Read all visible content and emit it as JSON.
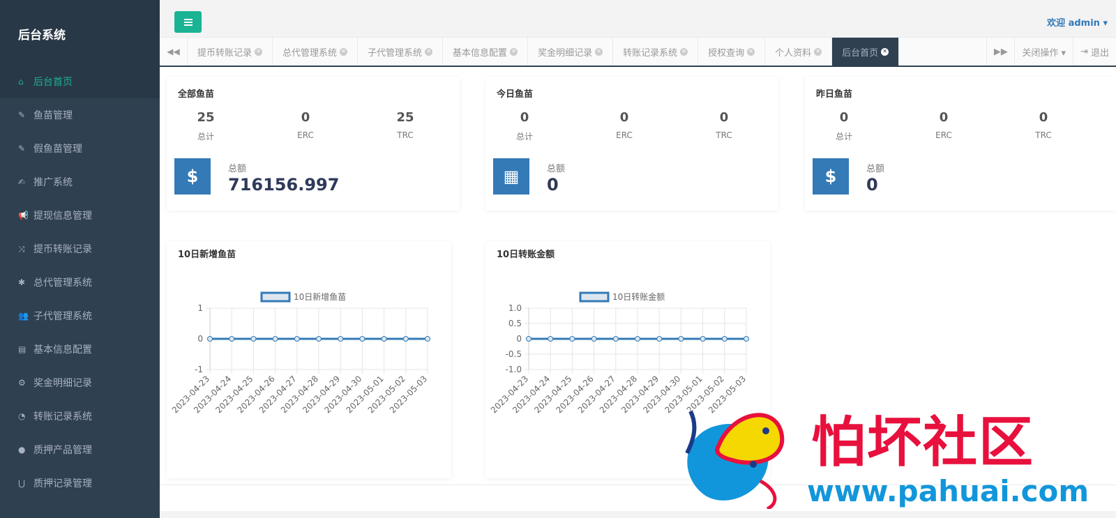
{
  "app": {
    "brand": "后台系统"
  },
  "sidebar": {
    "items": [
      {
        "label": "后台首页",
        "icon": "home-icon",
        "active": true
      },
      {
        "label": "鱼苗管理",
        "icon": "wrench-icon"
      },
      {
        "label": "假鱼苗管理",
        "icon": "wrench-icon"
      },
      {
        "label": "推广系统",
        "icon": "edit-icon"
      },
      {
        "label": "提现信息管理",
        "icon": "bullhorn-icon"
      },
      {
        "label": "提币转账记录",
        "icon": "random-icon"
      },
      {
        "label": "总代管理系统",
        "icon": "asterisk-icon"
      },
      {
        "label": "子代管理系统",
        "icon": "users-icon"
      },
      {
        "label": "基本信息配置",
        "icon": "file-icon"
      },
      {
        "label": "奖金明细记录",
        "icon": "cogs-icon"
      },
      {
        "label": "转账记录系统",
        "icon": "dashboard-icon"
      },
      {
        "label": "质押产品管理",
        "icon": "comment-icon"
      },
      {
        "label": "质押记录管理",
        "icon": "magnet-icon"
      }
    ]
  },
  "topbar": {
    "welcome": "欢迎 admin ▾"
  },
  "tabs": {
    "items": [
      {
        "label": "提币转账记录"
      },
      {
        "label": "总代管理系统"
      },
      {
        "label": "子代管理系统"
      },
      {
        "label": "基本信息配置"
      },
      {
        "label": "奖金明细记录"
      },
      {
        "label": "转账记录系统"
      },
      {
        "label": "授权查询"
      },
      {
        "label": "个人资料"
      },
      {
        "label": "后台首页",
        "active": true
      }
    ],
    "close_ops": "关闭操作 ▾",
    "logout": "退出"
  },
  "stats": [
    {
      "title": "全部鱼苗",
      "total": "25",
      "erc": "0",
      "trc": "25",
      "total_label": "总计",
      "erc_label": "ERC",
      "trc_label": "TRC",
      "amount_label": "总额",
      "amount": "716156.997",
      "icon": "dollar-icon"
    },
    {
      "title": "今日鱼苗",
      "total": "0",
      "erc": "0",
      "trc": "0",
      "total_label": "总计",
      "erc_label": "ERC",
      "trc_label": "TRC",
      "amount_label": "总额",
      "amount": "0",
      "icon": "archive-icon"
    },
    {
      "title": "昨日鱼苗",
      "total": "0",
      "erc": "0",
      "trc": "0",
      "total_label": "总计",
      "erc_label": "ERC",
      "trc_label": "TRC",
      "amount_label": "总额",
      "amount": "0",
      "icon": "dollar-icon"
    }
  ],
  "chart_data": [
    {
      "type": "line",
      "title": "10日新增鱼苗",
      "categories": [
        "2023-04-23",
        "2023-04-24",
        "2023-04-25",
        "2023-04-26",
        "2023-04-27",
        "2023-04-28",
        "2023-04-29",
        "2023-04-30",
        "2023-05-01",
        "2023-05-02",
        "2023-05-03"
      ],
      "series": [
        {
          "name": "10日新增鱼苗",
          "values": [
            0,
            0,
            0,
            0,
            0,
            0,
            0,
            0,
            0,
            0,
            0
          ]
        }
      ],
      "ylim": [
        -1,
        1
      ],
      "yticks": [
        "1",
        "0",
        "-1"
      ],
      "grid": true,
      "legend": "top",
      "color": "#337ab7"
    },
    {
      "type": "line",
      "title": "10日转账金额",
      "categories": [
        "2023-04-23",
        "2023-04-24",
        "2023-04-25",
        "2023-04-26",
        "2023-04-27",
        "2023-04-28",
        "2023-04-29",
        "2023-04-30",
        "2023-05-01",
        "2023-05-02",
        "2023-05-03"
      ],
      "series": [
        {
          "name": "10日转账金额",
          "values": [
            0,
            0,
            0,
            0,
            0,
            0,
            0,
            0,
            0,
            0,
            0
          ]
        }
      ],
      "ylim": [
        -1,
        1
      ],
      "yticks": [
        "1.0",
        "0.5",
        "0",
        "-0.5",
        "-1.0"
      ],
      "grid": true,
      "legend": "top",
      "color": "#337ab7"
    }
  ],
  "watermark": {
    "text": "怕坏社区",
    "url": "www.pahuai.com"
  },
  "colors": {
    "sidebar": "#2f4050",
    "accent": "#1ab394",
    "primary": "#337ab7",
    "watermark_red": "#e8103d",
    "watermark_blue": "#1296db"
  }
}
